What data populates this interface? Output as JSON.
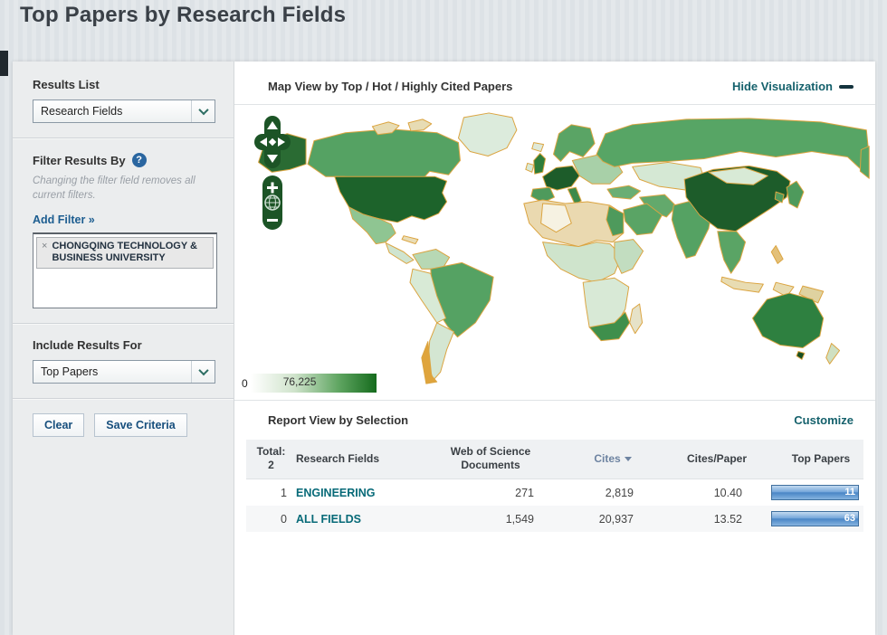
{
  "page": {
    "title": "Top Papers by Research Fields"
  },
  "sidebar": {
    "results_list_label": "Results List",
    "results_list_value": "Research Fields",
    "filter_heading": "Filter Results By",
    "help_icon_glyph": "?",
    "filter_note": "Changing the filter field removes all current filters.",
    "add_filter_label": "Add Filter »",
    "filter_tag": {
      "remove_glyph": "×",
      "label": "CHONGQING TECHNOLOGY & BUSINESS UNIVERSITY"
    },
    "include_results_label": "Include Results For",
    "include_results_value": "Top Papers",
    "clear_button": "Clear",
    "save_button": "Save Criteria"
  },
  "map_section": {
    "title": "Map View by Top / Hot / Highly Cited Papers",
    "hide_link": "Hide Visualization",
    "legend": {
      "min": "0",
      "max": "76,225"
    },
    "controls": {
      "zoom_in": "+",
      "zoom_out": "−"
    },
    "choropleth_colors": {
      "border": "#dba440",
      "none": "#f4eed6",
      "low": "#d9ebd7",
      "mid": "#55a263",
      "high": "#1d5c2a"
    }
  },
  "report": {
    "title": "Report View by Selection",
    "customize_link": "Customize",
    "total_label": "Total:",
    "total_value": "2",
    "columns": [
      "Research Fields",
      "Web of Science Documents",
      "Cites",
      "Cites/Paper",
      "Top Papers"
    ],
    "rows": [
      {
        "rank": "1",
        "field": "ENGINEERING",
        "wos_documents": "271",
        "cites": "2,819",
        "cites_per_paper": "10.40",
        "top_papers": "11"
      },
      {
        "rank": "0",
        "field": "ALL FIELDS",
        "wos_documents": "1,549",
        "cites": "20,937",
        "cites_per_paper": "13.52",
        "top_papers": "63"
      }
    ]
  }
}
